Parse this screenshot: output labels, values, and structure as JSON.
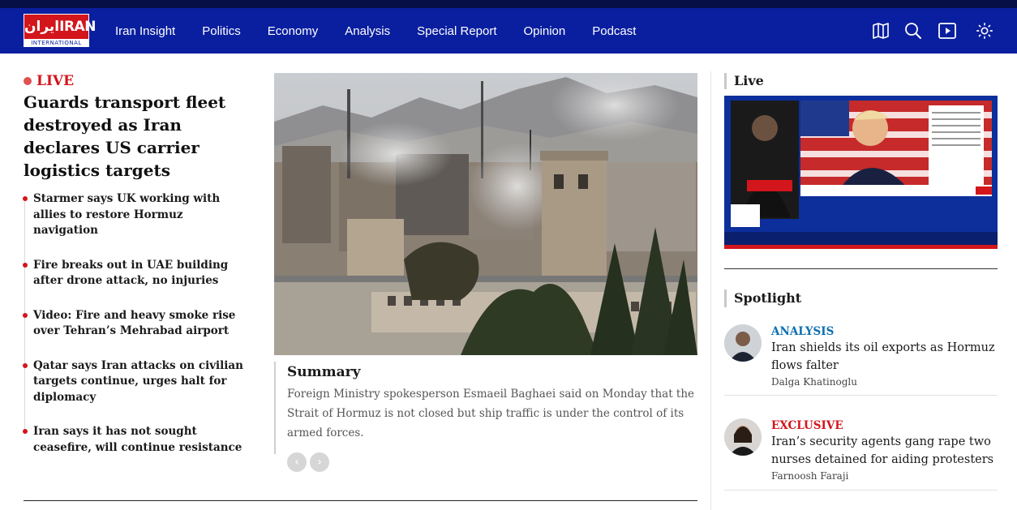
{
  "brand": {
    "logo_text": "ايران",
    "logo_word": "IRAN",
    "logo_sub": "INTERNATIONAL",
    "primary_color": "#0a1f9f",
    "accent_color": "#d3151c"
  },
  "nav": {
    "items": [
      {
        "label": "Iran Insight"
      },
      {
        "label": "Politics"
      },
      {
        "label": "Economy"
      },
      {
        "label": "Analysis"
      },
      {
        "label": "Special Report"
      },
      {
        "label": "Opinion"
      },
      {
        "label": "Podcast"
      }
    ],
    "icons": [
      "map-icon",
      "search-icon",
      "video-play-icon",
      "sun-icon"
    ]
  },
  "live_block": {
    "badge": "LIVE",
    "headline": "Guards transport fleet destroyed as Iran declares US carrier logistics targets",
    "updates": [
      {
        "text": "Starmer says UK working with allies to restore Hormuz navigation"
      },
      {
        "text": "Fire breaks out in UAE building after drone attack, no injuries"
      },
      {
        "text": "Video: Fire and heavy smoke rise over Tehran’s Mehrabad airport"
      },
      {
        "text": "Qatar says Iran attacks on civilian targets continue, urges halt for diplomacy"
      },
      {
        "text": "Iran says it has not sought ceasefire, will continue resistance"
      }
    ]
  },
  "summary": {
    "heading": "Summary",
    "text": "Foreign Ministry spokesperson Esmaeil Baghaei said on Monday that the Strait of Hormuz is not closed but ship traffic is under the control of its armed forces.",
    "prev_icon": "‹",
    "next_icon": "›"
  },
  "right": {
    "live_heading": "Live",
    "spotlight_heading": "Spotlight",
    "spotlight": [
      {
        "kicker": "ANALYSIS",
        "kicker_color": "#0b6fb0",
        "title": "Iran shields its oil exports as Hormuz flows falter",
        "author": "Dalga Khatinoglu"
      },
      {
        "kicker": "EXCLUSIVE",
        "kicker_color": "#d3151c",
        "title": "Iran’s security agents gang rape two nurses detained for aiding protesters",
        "author": "Farnoosh Faraji"
      }
    ]
  }
}
